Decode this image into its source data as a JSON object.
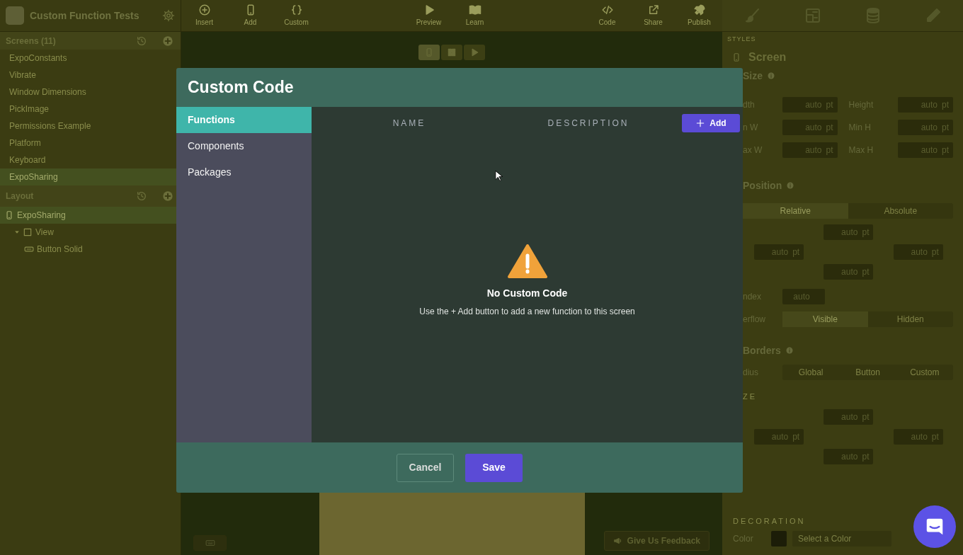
{
  "app": {
    "title": "Custom Function Tests"
  },
  "toolbar_groups": [
    {
      "items": [
        {
          "label": "Insert"
        },
        {
          "label": "Add"
        },
        {
          "label": "Custom"
        }
      ]
    },
    {
      "items": [
        {
          "label": "Preview"
        },
        {
          "label": "Learn"
        }
      ]
    },
    {
      "items": [
        {
          "label": "Code"
        },
        {
          "label": "Share"
        },
        {
          "label": "Publish"
        }
      ]
    }
  ],
  "screens_panel": {
    "title": "Screens (11)",
    "items": [
      {
        "label": "ExpoConstants",
        "selected": false
      },
      {
        "label": "Vibrate",
        "selected": false
      },
      {
        "label": "Window Dimensions",
        "selected": false
      },
      {
        "label": "PickImage",
        "selected": false
      },
      {
        "label": "Permissions Example",
        "selected": false
      },
      {
        "label": "Platform",
        "selected": false
      },
      {
        "label": "Keyboard",
        "selected": false
      },
      {
        "label": "ExpoSharing",
        "selected": true
      }
    ]
  },
  "layout_panel": {
    "title": "Layout",
    "tree": [
      {
        "label": "ExpoSharing",
        "kind": "screen",
        "selected": true,
        "children": [
          {
            "label": "View",
            "kind": "view",
            "selected": false,
            "children": [
              {
                "label": "Button Solid",
                "kind": "button",
                "selected": false
              }
            ]
          }
        ]
      }
    ]
  },
  "device_modes": [
    {
      "selected": true
    },
    {
      "selected": false
    },
    {
      "selected": false
    }
  ],
  "feedback_button": "Give Us Feedback",
  "styles": {
    "heading": "STYLES",
    "element": "Screen",
    "size": {
      "title": "Size",
      "fields": [
        {
          "label": "dth",
          "value": "auto",
          "unit": "pt"
        },
        {
          "label": "Height",
          "value": "auto",
          "unit": "pt"
        },
        {
          "label": "n W",
          "value": "auto",
          "unit": "pt"
        },
        {
          "label": "Min H",
          "value": "auto",
          "unit": "pt"
        },
        {
          "label": "ax W",
          "value": "auto",
          "unit": "pt"
        },
        {
          "label": "Max H",
          "value": "auto",
          "unit": "pt"
        }
      ]
    },
    "position": {
      "title": "Position",
      "modes": [
        {
          "label": "Relative",
          "selected": true
        },
        {
          "label": "Absolute",
          "selected": false
        }
      ],
      "offsets": [
        {
          "value": "auto",
          "unit": "pt"
        },
        {
          "value": "auto",
          "unit": "pt"
        },
        {
          "value": "auto",
          "unit": "pt"
        },
        {
          "value": "auto",
          "unit": "pt"
        }
      ],
      "z_index": {
        "label": "ndex",
        "value": "auto"
      },
      "overflow": {
        "label": "erflow",
        "options": [
          {
            "label": "Visible",
            "selected": true
          },
          {
            "label": "Hidden",
            "selected": false
          }
        ]
      }
    },
    "borders": {
      "title": "Borders",
      "radius_label": "dius",
      "radius_options": [
        {
          "label": "Global",
          "selected": false
        },
        {
          "label": "Button",
          "selected": false
        },
        {
          "label": "Custom",
          "selected": false
        }
      ],
      "size_label": "ZE",
      "widths": [
        {
          "value": "auto",
          "unit": "pt"
        },
        {
          "value": "auto",
          "unit": "pt"
        },
        {
          "value": "auto",
          "unit": "pt"
        },
        {
          "value": "auto",
          "unit": "pt"
        }
      ]
    },
    "decoration": {
      "title": "DECORATION",
      "color_label": "Color",
      "color_placeholder": "Select a Color"
    }
  },
  "modal": {
    "title": "Custom Code",
    "tabs": [
      {
        "label": "Functions",
        "selected": true
      },
      {
        "label": "Components",
        "selected": false
      },
      {
        "label": "Packages",
        "selected": false
      }
    ],
    "columns": [
      "NAME",
      "DESCRIPTION"
    ],
    "add_button": "Add",
    "empty_state": {
      "title": "No Custom Code",
      "message": "Use the + Add button to add a new function to this screen"
    },
    "buttons": [
      {
        "label": "Cancel",
        "kind": "secondary"
      },
      {
        "label": "Save",
        "kind": "primary"
      }
    ]
  }
}
